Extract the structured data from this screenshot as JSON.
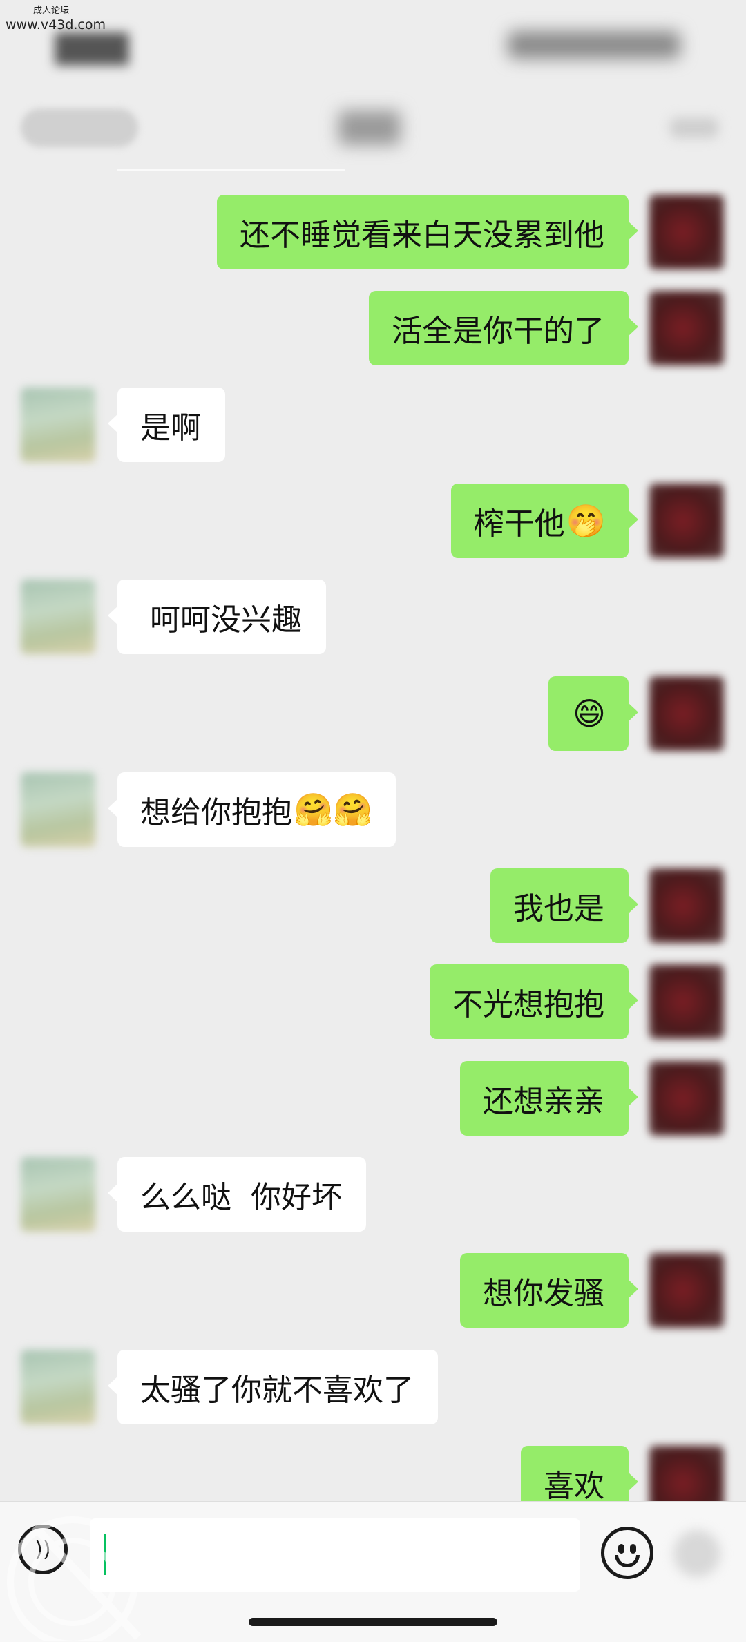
{
  "watermark": {
    "line1": "成人论坛",
    "line2": "www.v43d.com"
  },
  "messages": [
    {
      "side": "right",
      "text": "还不睡觉看来白天没累到他",
      "emoji": ""
    },
    {
      "side": "right",
      "text": "活全是你干的了",
      "emoji": ""
    },
    {
      "side": "left",
      "text": "是啊",
      "emoji": ""
    },
    {
      "side": "right",
      "text": "榨干他",
      "emoji": "🤭"
    },
    {
      "side": "left",
      "text": " 呵呵没兴趣",
      "emoji": ""
    },
    {
      "side": "right",
      "text": "",
      "emoji": "😄"
    },
    {
      "side": "left",
      "text": "想给你抱抱",
      "emoji": "🤗🤗"
    },
    {
      "side": "right",
      "text": "我也是",
      "emoji": ""
    },
    {
      "side": "right",
      "text": "不光想抱抱",
      "emoji": ""
    },
    {
      "side": "right",
      "text": "还想亲亲",
      "emoji": ""
    },
    {
      "side": "left",
      "text": "么么哒  你好坏",
      "emoji": ""
    },
    {
      "side": "right",
      "text": "想你发骚",
      "emoji": ""
    },
    {
      "side": "left",
      "text": "太骚了你就不喜欢了",
      "emoji": ""
    },
    {
      "side": "right",
      "text": "喜欢",
      "emoji": ""
    }
  ],
  "input_bar": {
    "voice_icon": "voice-icon",
    "emoji_icon": "emoji-icon",
    "plus_icon": "plus-icon",
    "input_value": ""
  },
  "colors": {
    "outgoing_bubble": "#95ec69",
    "incoming_bubble": "#ffffff",
    "background": "#ededed"
  }
}
